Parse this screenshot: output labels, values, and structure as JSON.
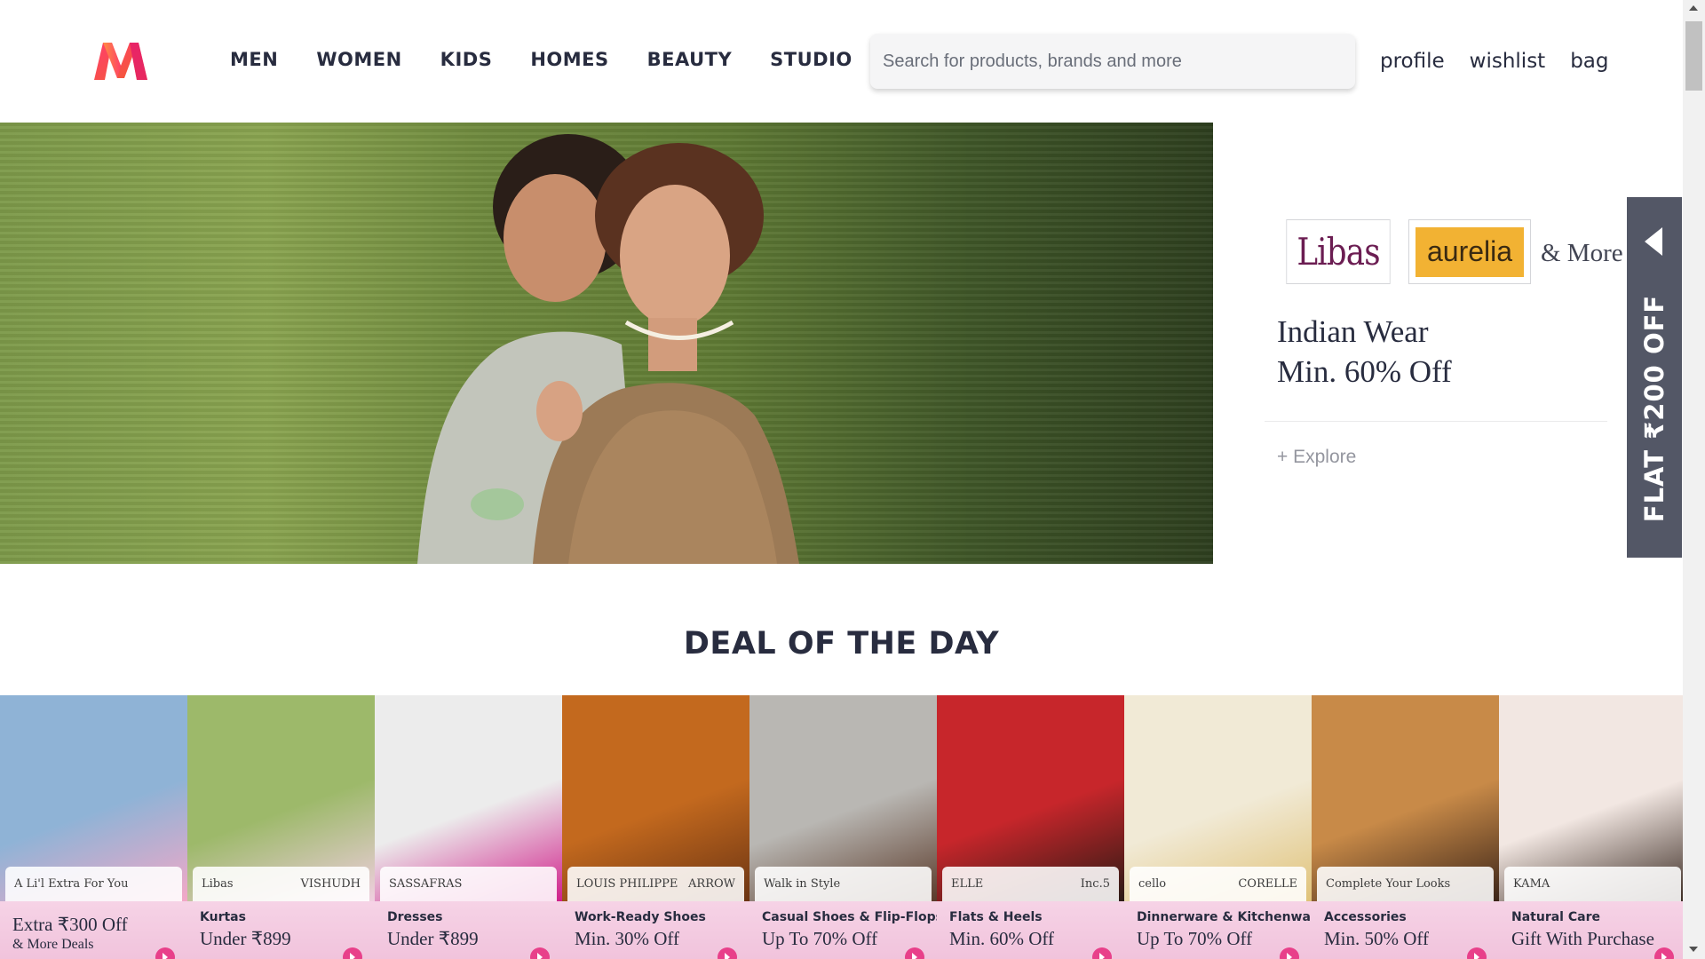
{
  "header": {
    "nav": [
      "MEN",
      "WOMEN",
      "KIDS",
      "HOMES",
      "BEAUTY",
      "STUDIO"
    ],
    "search_placeholder": "Search for products, brands and more",
    "links": [
      "profile",
      "wishlist",
      "bag"
    ]
  },
  "promo": {
    "brand1": "Libas",
    "brand2": "aurelia",
    "and_more": "& More",
    "title_line1": "Indian Wear",
    "title_line2": "Min. 60% Off",
    "explore": "+ Explore"
  },
  "side_tab": {
    "label": "FLAT ₹200 OFF"
  },
  "section_title": "DEAL OF THE DAY",
  "deals": [
    {
      "brands": [
        "A Li'l Extra For You",
        ""
      ],
      "category": "",
      "offer": "Extra ₹300 Off",
      "offer2": "& More Deals",
      "bg": "#8fb3d6",
      "accent": "#f3a8c7"
    },
    {
      "brands": [
        "Libas",
        "VISHUDH"
      ],
      "category": "Kurtas",
      "offer": "Under ₹899",
      "offer2": "",
      "bg": "#9db96a",
      "accent": "#f0cfe0"
    },
    {
      "brands": [
        "SASSAFRAS",
        ""
      ],
      "category": "Dresses",
      "offer": "Under ₹899",
      "offer2": "",
      "bg": "#ececec",
      "accent": "#d01f8a"
    },
    {
      "brands": [
        "LOUIS PHILIPPE",
        "ARROW"
      ],
      "category": "Work-Ready Shoes",
      "offer": "Min. 30% Off",
      "offer2": "",
      "bg": "#c3691e",
      "accent": "#6b3413"
    },
    {
      "brands": [
        "Walk in Style",
        ""
      ],
      "category": "Casual Shoes & Flip-Flops",
      "offer": "Up To 70% Off",
      "offer2": "",
      "bg": "#b9b7b3",
      "accent": "#5a3a2a"
    },
    {
      "brands": [
        "ELLE",
        "Inc.5"
      ],
      "category": "Flats & Heels",
      "offer": "Min. 60% Off",
      "offer2": "",
      "bg": "#c7262b",
      "accent": "#2a1a14"
    },
    {
      "brands": [
        "cello",
        "CORELLE"
      ],
      "category": "Dinnerware & Kitchenware",
      "offer": "Up To 70% Off",
      "offer2": "",
      "bg": "#f1ead6",
      "accent": "#e0c278"
    },
    {
      "brands": [
        "Complete Your Looks",
        ""
      ],
      "category": "Accessories",
      "offer": "Min. 50% Off",
      "offer2": "",
      "bg": "#c88a48",
      "accent": "#3b2418"
    },
    {
      "brands": [
        "KAMA",
        ""
      ],
      "category": "Natural Care",
      "offer": "Gift With Purchase",
      "offer2": "",
      "bg": "#f2e7e2",
      "accent": "#3a2a22"
    }
  ]
}
